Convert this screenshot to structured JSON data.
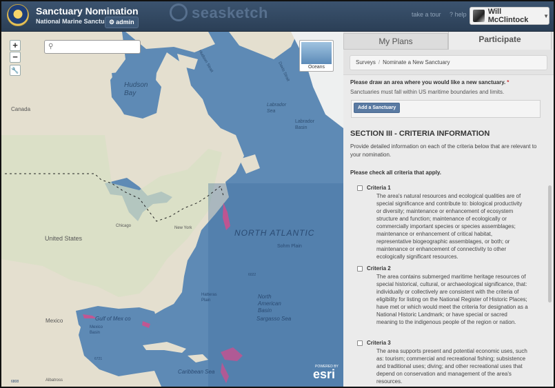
{
  "header": {
    "title": "Sanctuary Nomination",
    "subtitle": "National Marine Sanctuaries",
    "admin_badge": "admin",
    "brand": "seasketch",
    "take_tour": "take a tour",
    "help": "help",
    "user_name": "Will McClintock"
  },
  "map": {
    "zoom_in": "+",
    "zoom_out": "−",
    "search_placeholder": "",
    "basemap_label": "Oceans",
    "powered_by": "POWERED BY",
    "esri": "esri",
    "labels": {
      "hudson_bay": "Hudson\nBay",
      "canada": "Canada",
      "hudson_strait": "Hudson Strait",
      "davis_strait": "Davis Strait",
      "labrador": "Labrador\nSea",
      "labrador_basin": "Labrador\nBasin",
      "chicago": "Chicago",
      "new_york": "New York",
      "united_states": "United States",
      "north_atlantic": "NORTH ATLANTIC",
      "sohm_plain": "Sohm Plain",
      "hatteras": "Hatteras\nPlain",
      "north_american_basin": "North\nAmerican\nBasin",
      "sargasso": "Sargasso Sea",
      "mexico": "Mexico",
      "gulf": "Gulf of Mex co",
      "mexico_basin": "Mexico\nBasin",
      "caribbean": "Caribbean Sea",
      "albatross": "Albatross",
      "depth_6022": "6022",
      "depth_6721": "6721",
      "depth_6808": "6808"
    }
  },
  "panel": {
    "tabs": [
      "My Plans",
      "Participate"
    ],
    "breadcrumb": [
      "Surveys",
      "Nominate a New Sanctuary"
    ],
    "question": "Please draw an area where you would like a new sanctuary.",
    "required_mark": "*",
    "question_help": "Sanctuaries must fall within US maritime boundaries and limits.",
    "add_button": "Add a Sanctuary",
    "section_title": "SECTION III - CRITERIA INFORMATION",
    "section_desc": "Provide detailed information on each of the criteria below that are relevant to your nomination.",
    "check_prompt": "Please check all criteria that apply.",
    "criteria": [
      {
        "title": "Criteria 1",
        "desc": "The area's natural resources and ecological qualities are of special significance and contribute to: biological productivity or diversity; maintenance or enhancement of ecosystem structure and function; maintenance of ecologically or commercially important species or species assemblages; maintenance or enhancement of critical habitat, representative biogeographic assemblages, or both; or maintenance or enhancement of connectivity to other ecologically significant resources."
      },
      {
        "title": "Criteria 2",
        "desc": "The area contains submerged maritime heritage resources of special historical, cultural, or archaeological significance, that: individually or collectively are consistent with the criteria of eligibility for listing on the National Register of Historic Places; have met or which would meet the criteria for designation as a National Historic Landmark; or have special or sacred meaning to the indigenous people of the region or nation."
      },
      {
        "title": "Criteria 3",
        "desc": "The area supports present and potential economic uses, such as: tourism; commercial and recreational fishing; subsistence and traditional uses; diving; and other recreational uses that depend on conservation and management of the area's resources."
      }
    ]
  }
}
